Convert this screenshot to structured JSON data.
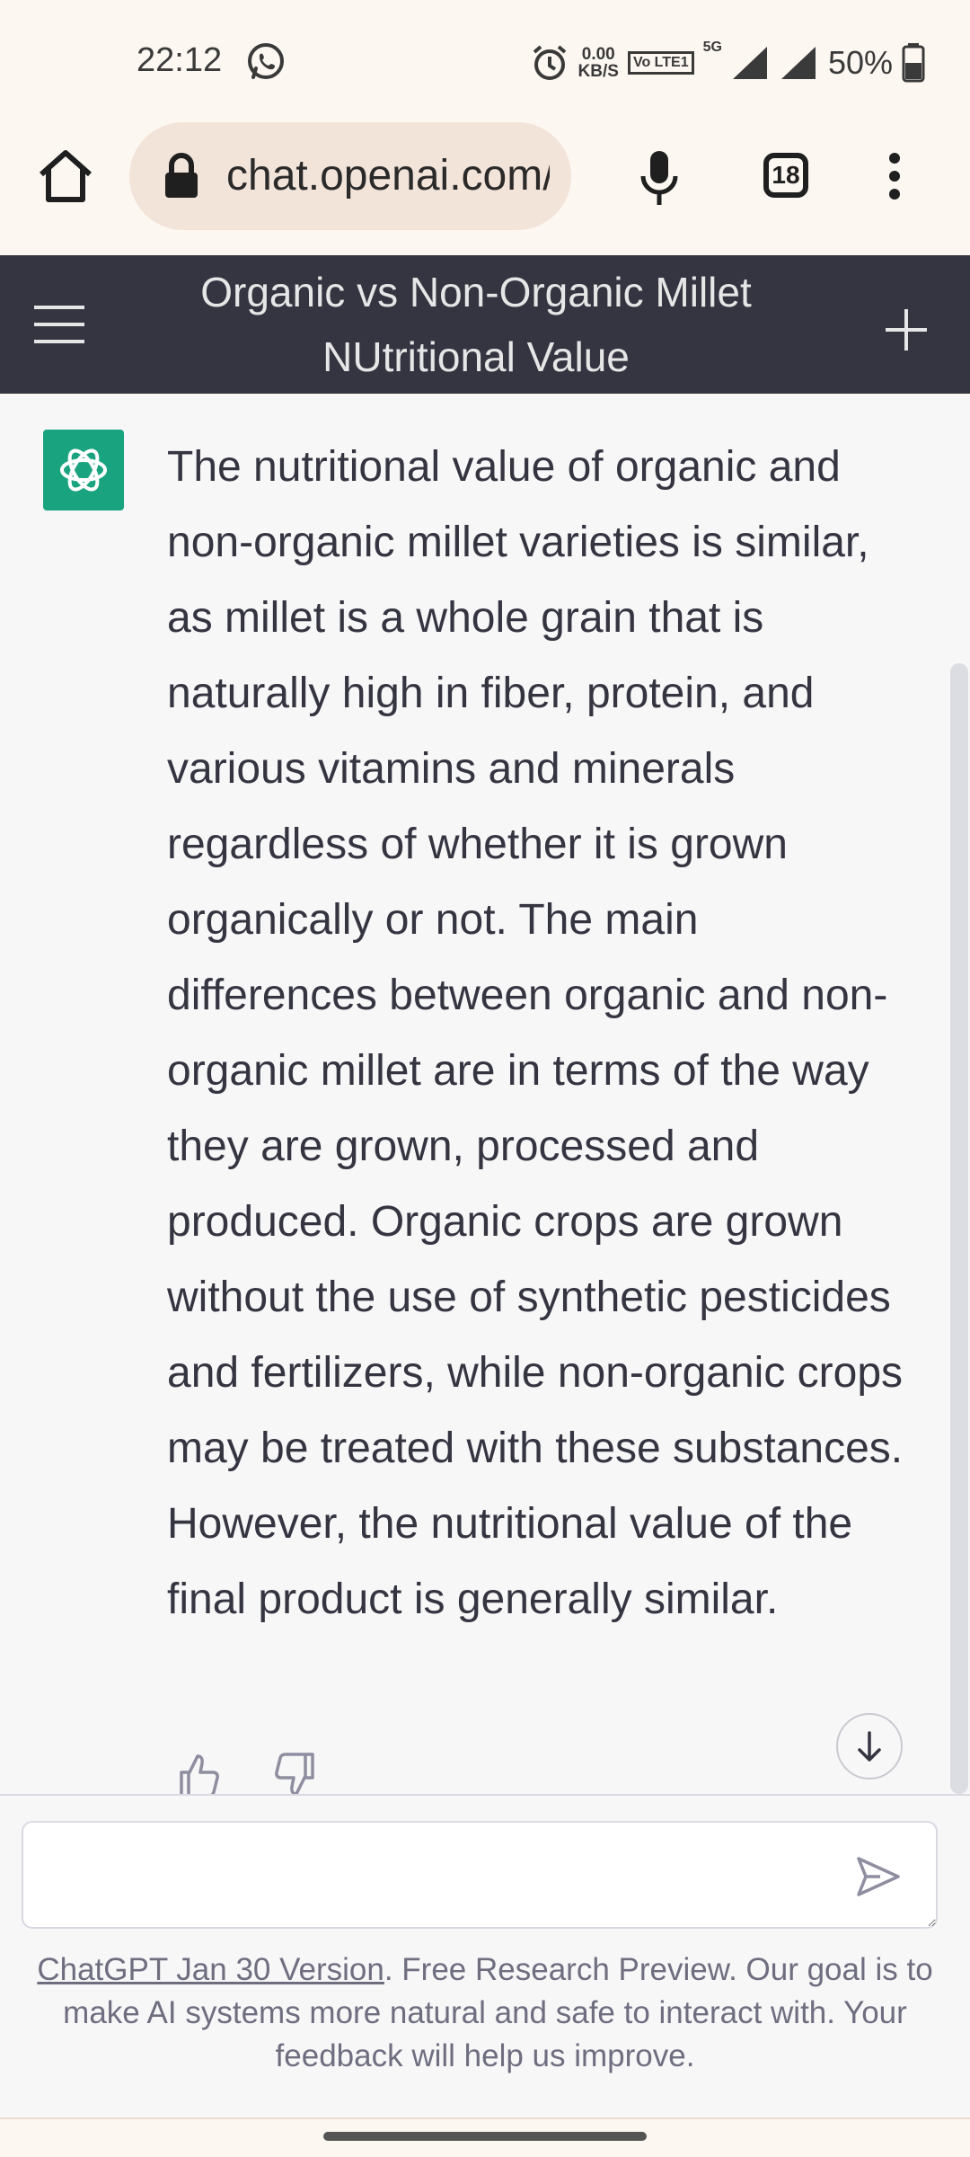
{
  "status_bar": {
    "time": "22:12",
    "net_speed_value": "0.00",
    "net_speed_unit": "KB/S",
    "volte": "Vo LTE1",
    "network": "5G",
    "battery": "50%",
    "icons": [
      "whatsapp-icon",
      "alarm-icon",
      "signal-icon",
      "battery-icon"
    ]
  },
  "browser": {
    "url": "chat.openai.com/",
    "tab_count": "18",
    "icons": [
      "home-icon",
      "lock-icon",
      "microphone-icon",
      "tabs-icon",
      "more-vert-icon"
    ]
  },
  "chat_header": {
    "title": "Organic vs Non-Organic Millet NUtritional Value",
    "icons": [
      "menu-icon",
      "new-chat-icon"
    ]
  },
  "message": {
    "text": "The nutritional value of organic and non-organic millet varieties is similar, as millet is a whole grain that is naturally high in fiber, protein, and various vitamins and minerals regardless of whether it is grown organically or not. The main differences between organic and non-organic millet are in terms of the way they are grown, processed and produced. Organic crops are grown without the use of synthetic pesticides and fertilizers, while non-organic crops may be treated with these substances. However, the nutritional value of the final product is generally similar."
  },
  "input": {
    "placeholder": "",
    "value": ""
  },
  "footer": {
    "link": "ChatGPT Jan 30 Version",
    "text": ". Free Research Preview. Our goal is to make AI systems more natural and safe to interact with. Your feedback will help us improve."
  },
  "colors": {
    "header_bg": "#343541",
    "avatar_bg": "#19a37f",
    "content_bg": "#f7f7f8",
    "browser_bg": "#fdf7f2",
    "url_pill_bg": "#f3e4da"
  }
}
